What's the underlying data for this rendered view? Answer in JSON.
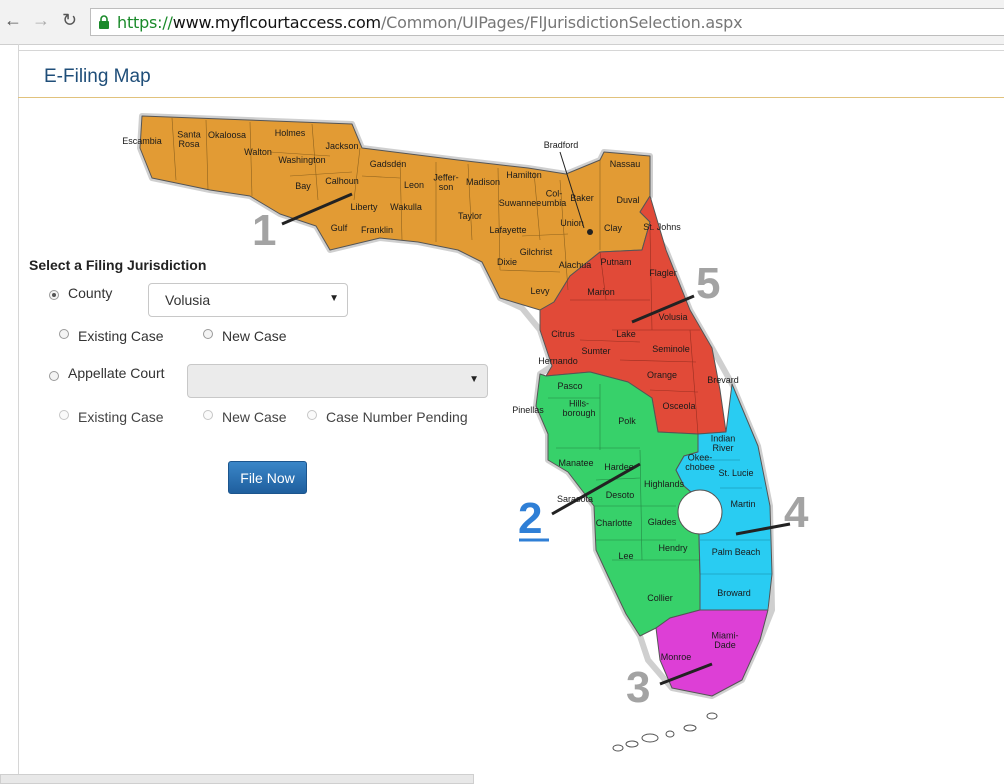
{
  "browser": {
    "back_icon": "arrow-left-icon",
    "forward_icon": "arrow-right-icon",
    "reload_icon": "reload-icon",
    "url_scheme": "https://",
    "url_host": "www.myflcourtaccess.com",
    "url_path": "/Common/UIPages/FlJurisdictionSelection.aspx"
  },
  "page": {
    "title": "E-Filing Map"
  },
  "form": {
    "heading": "Select a Filing Jurisdiction",
    "county_label": "County",
    "county_selected": "Volusia",
    "existing_case": "Existing Case",
    "new_case": "New Case",
    "appellate_label": "Appellate Court",
    "appellate_selected": "",
    "case_number_pending": "Case Number Pending",
    "file_now": "File Now"
  },
  "map": {
    "colors": {
      "region1": "#e29b34",
      "region2": "#37d16a",
      "region3": "#dd3fd6",
      "region4": "#29ccf2",
      "region5": "#e14a38"
    },
    "region_numbers": [
      "1",
      "2",
      "3",
      "4",
      "5"
    ],
    "counties": {
      "escambia": "Escambia",
      "santa_rosa": "Santa\nRosa",
      "okaloosa": "Okaloosa",
      "walton": "Walton",
      "holmes": "Holmes",
      "washington": "Washington",
      "jackson": "Jackson",
      "bay": "Bay",
      "calhoun": "Calhoun",
      "gadsden": "Gadsden",
      "liberty": "Liberty",
      "gulf": "Gulf",
      "franklin": "Franklin",
      "leon": "Leon",
      "wakulla": "Wakulla",
      "jefferson": "Jeffer-\nson",
      "madison": "Madison",
      "taylor": "Taylor",
      "hamilton": "Hamilton",
      "suwannee": "Suwannee",
      "columbia": "Col-\numbia",
      "lafayette": "Lafayette",
      "dixie": "Dixie",
      "gilchrist": "Gilchrist",
      "levy": "Levy",
      "alachua": "Alachua",
      "union": "Union",
      "baker": "Baker",
      "bradford": "Bradford",
      "nassau": "Nassau",
      "duval": "Duval",
      "clay": "Clay",
      "st_johns": "St. Johns",
      "putnam": "Putnam",
      "flagler": "Flagler",
      "marion": "Marion",
      "volusia": "Volusia",
      "lake": "Lake",
      "citrus": "Citrus",
      "sumter": "Sumter",
      "hernando": "Hernando",
      "seminole": "Seminole",
      "orange": "Orange",
      "brevard": "Brevard",
      "osceola": "Osceola",
      "pasco": "Pasco",
      "pinellas": "Pinellas",
      "hillsborough": "Hills-\nborough",
      "polk": "Polk",
      "manatee": "Manatee",
      "hardee": "Hardee",
      "highlands": "Highlands",
      "sarasota": "Sarasota",
      "desoto": "Desoto",
      "charlotte": "Charlotte",
      "glades": "Glades",
      "lee": "Lee",
      "hendry": "Hendry",
      "collier": "Collier",
      "indian_river": "Indian\nRiver",
      "okeechobee": "Okee-\nchobee",
      "st_lucie": "St. Lucie",
      "martin": "Martin",
      "palm_beach": "Palm Beach",
      "broward": "Broward",
      "monroe": "Monroe",
      "miami_dade": "Miami-\nDade"
    }
  }
}
